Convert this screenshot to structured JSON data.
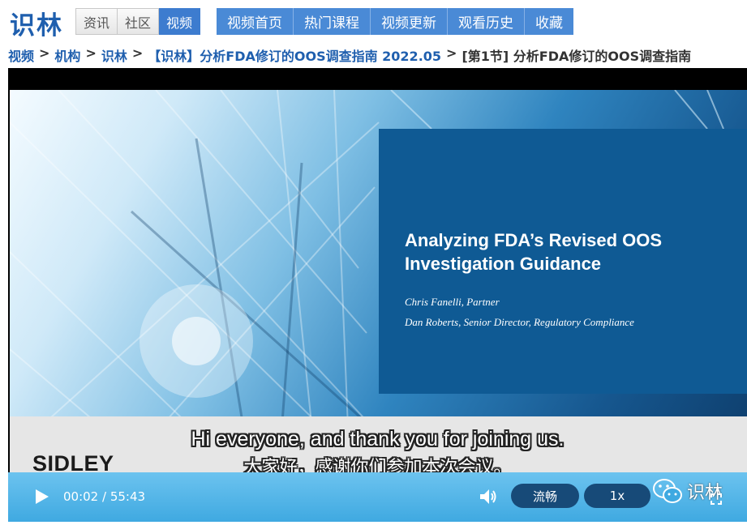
{
  "site": {
    "logo": "识林"
  },
  "segments": [
    {
      "label": "资讯",
      "active": false
    },
    {
      "label": "社区",
      "active": false
    },
    {
      "label": "视频",
      "active": true
    }
  ],
  "nav": [
    "视频首页",
    "热门课程",
    "视频更新",
    "观看历史",
    "收藏"
  ],
  "breadcrumb": {
    "items": [
      "视频",
      "机构",
      "识林",
      "【识林】分析FDA修订的OOS调查指南 2022.05"
    ],
    "current": "[第1节] 分析FDA修订的OOS调查指南",
    "separator": ">"
  },
  "slide": {
    "title": "Analyzing FDA’s Revised OOS Investigation Guidance",
    "presenters": [
      "Chris Fanelli, Partner",
      "Dan Roberts, Senior Director, Regulatory Compliance"
    ],
    "company": "SIDLEY"
  },
  "subtitles": {
    "english": "Hi everyone, and thank you for joining us.",
    "chinese": "大家好，感谢你们参加本次会议。"
  },
  "player": {
    "current_time": "00:02",
    "duration": "55:43",
    "time_display": "00:02 / 55:43",
    "quality": "流畅",
    "speed": "1x",
    "watermark": "识林"
  },
  "colors": {
    "brand": "#1f5fae",
    "nav": "#4a8ad6",
    "slide_box": "#0f5a94",
    "controls": "#3fa9e1"
  }
}
